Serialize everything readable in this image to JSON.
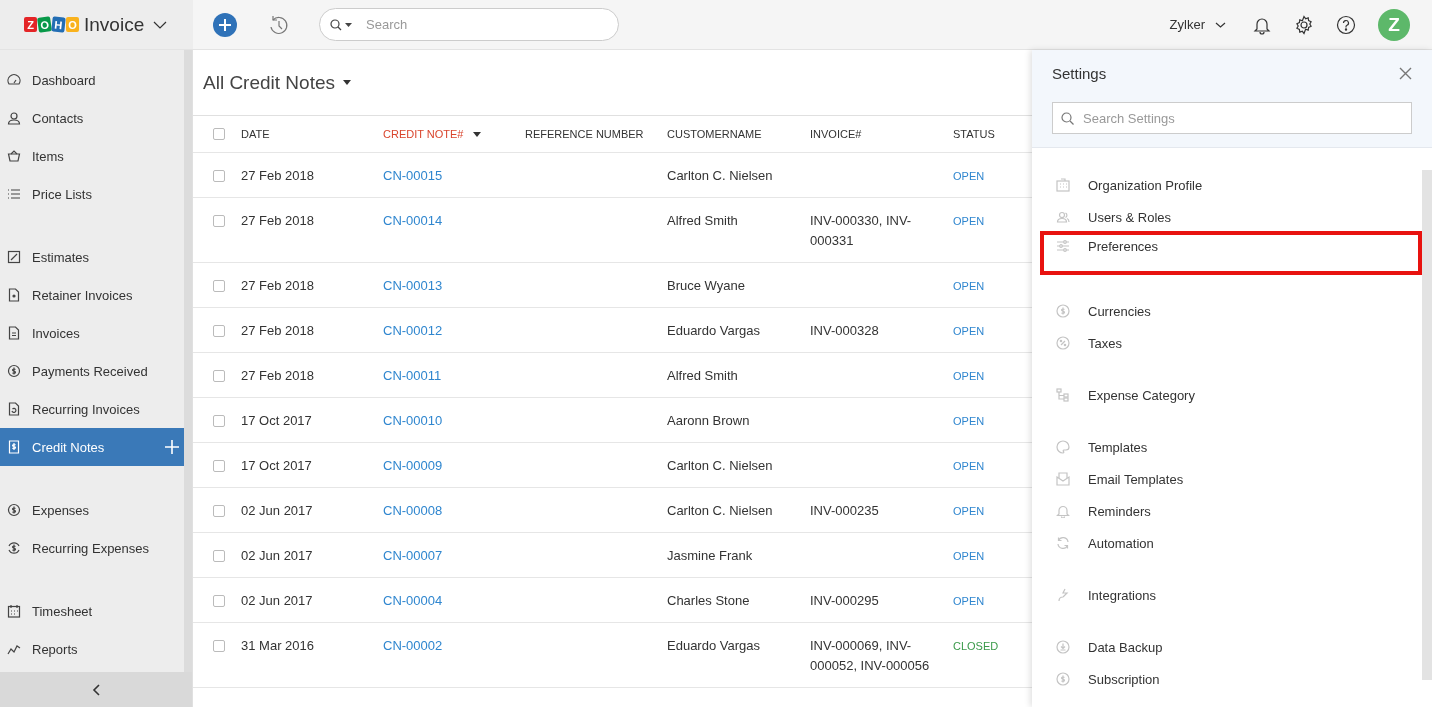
{
  "brand": {
    "letters": [
      "Z",
      "O",
      "H",
      "O"
    ],
    "product": "Invoice"
  },
  "topbar": {
    "search_placeholder": "Search",
    "org": "Zylker",
    "avatar": "Z"
  },
  "sidebar": {
    "groups": [
      [
        {
          "label": "Dashboard",
          "selected": false
        },
        {
          "label": "Contacts",
          "selected": false
        },
        {
          "label": "Items",
          "selected": false
        },
        {
          "label": "Price Lists",
          "selected": false
        }
      ],
      [
        {
          "label": "Estimates",
          "selected": false
        },
        {
          "label": "Retainer Invoices",
          "selected": false
        },
        {
          "label": "Invoices",
          "selected": false
        },
        {
          "label": "Payments Received",
          "selected": false
        },
        {
          "label": "Recurring Invoices",
          "selected": false
        },
        {
          "label": "Credit Notes",
          "selected": true
        }
      ],
      [
        {
          "label": "Expenses",
          "selected": false
        },
        {
          "label": "Recurring Expenses",
          "selected": false
        }
      ],
      [
        {
          "label": "Timesheet",
          "selected": false
        },
        {
          "label": "Reports",
          "selected": false
        }
      ]
    ]
  },
  "list": {
    "title": "All Credit Notes",
    "select_all": {
      "checked": false
    },
    "columns": [
      {
        "label": "DATE",
        "sorted": false
      },
      {
        "label": "CREDIT NOTE#",
        "sorted": true
      },
      {
        "label": "REFERENCE NUMBER",
        "sorted": false
      },
      {
        "label": "CUSTOMERNAME",
        "sorted": false
      },
      {
        "label": "INVOICE#",
        "sorted": false
      },
      {
        "label": "STATUS",
        "sorted": false
      }
    ],
    "rows": [
      {
        "checked": false,
        "date": "27 Feb 2018",
        "number": "CN-00015",
        "customer": "Carlton C. Nielsen",
        "invoice": "",
        "status": "OPEN",
        "color": "#2f86cf"
      },
      {
        "checked": false,
        "date": "27 Feb 2018",
        "number": "CN-00014",
        "customer": "Alfred Smith",
        "invoice": "INV-000330, INV-000331",
        "status": "OPEN",
        "color": "#2f86cf"
      },
      {
        "checked": false,
        "date": "27 Feb 2018",
        "number": "CN-00013",
        "customer": "Bruce Wyane",
        "invoice": "",
        "status": "OPEN",
        "color": "#2f86cf"
      },
      {
        "checked": false,
        "date": "27 Feb 2018",
        "number": "CN-00012",
        "customer": "Eduardo Vargas",
        "invoice": "INV-000328",
        "status": "OPEN",
        "color": "#2f86cf"
      },
      {
        "checked": false,
        "date": "27 Feb 2018",
        "number": "CN-00011",
        "customer": "Alfred Smith",
        "invoice": "",
        "status": "OPEN",
        "color": "#2f86cf"
      },
      {
        "checked": false,
        "date": "17 Oct 2017",
        "number": "CN-00010",
        "customer": "Aaronn Brown",
        "invoice": "",
        "status": "OPEN",
        "color": "#2f86cf"
      },
      {
        "checked": false,
        "date": "17 Oct 2017",
        "number": "CN-00009",
        "customer": "Carlton C. Nielsen",
        "invoice": "",
        "status": "OPEN",
        "color": "#2f86cf"
      },
      {
        "checked": false,
        "date": "02 Jun 2017",
        "number": "CN-00008",
        "customer": "Carlton C. Nielsen",
        "invoice": "INV-000235",
        "status": "OPEN",
        "color": "#2f86cf"
      },
      {
        "checked": false,
        "date": "02 Jun 2017",
        "number": "CN-00007",
        "customer": "Jasmine Frank",
        "invoice": "",
        "status": "OPEN",
        "color": "#2f86cf"
      },
      {
        "checked": false,
        "date": "02 Jun 2017",
        "number": "CN-00004",
        "customer": "Charles Stone",
        "invoice": "INV-000295",
        "status": "OPEN",
        "color": "#2f86cf"
      },
      {
        "checked": false,
        "date": "31 Mar 2016",
        "number": "CN-00002",
        "customer": "Eduardo Vargas",
        "invoice": "INV-000069, INV-000052, INV-000056",
        "status": "CLOSED",
        "color": "#3a9a4a"
      }
    ]
  },
  "settings": {
    "title": "Settings",
    "search_placeholder": "Search Settings",
    "groups": [
      [
        {
          "label": "Organization Profile",
          "highlighted": false
        },
        {
          "label": "Users & Roles",
          "highlighted": false
        },
        {
          "label": "Preferences",
          "highlighted": true
        }
      ],
      [
        {
          "label": "Currencies",
          "highlighted": false
        },
        {
          "label": "Taxes",
          "highlighted": false
        }
      ],
      [
        {
          "label": "Expense Category",
          "highlighted": false
        }
      ],
      [
        {
          "label": "Templates",
          "highlighted": false
        },
        {
          "label": "Email Templates",
          "highlighted": false
        },
        {
          "label": "Reminders",
          "highlighted": false
        },
        {
          "label": "Automation",
          "highlighted": false
        }
      ],
      [
        {
          "label": "Integrations",
          "highlighted": false
        }
      ],
      [
        {
          "label": "Data Backup",
          "highlighted": false
        },
        {
          "label": "Subscription",
          "highlighted": false
        }
      ]
    ]
  }
}
